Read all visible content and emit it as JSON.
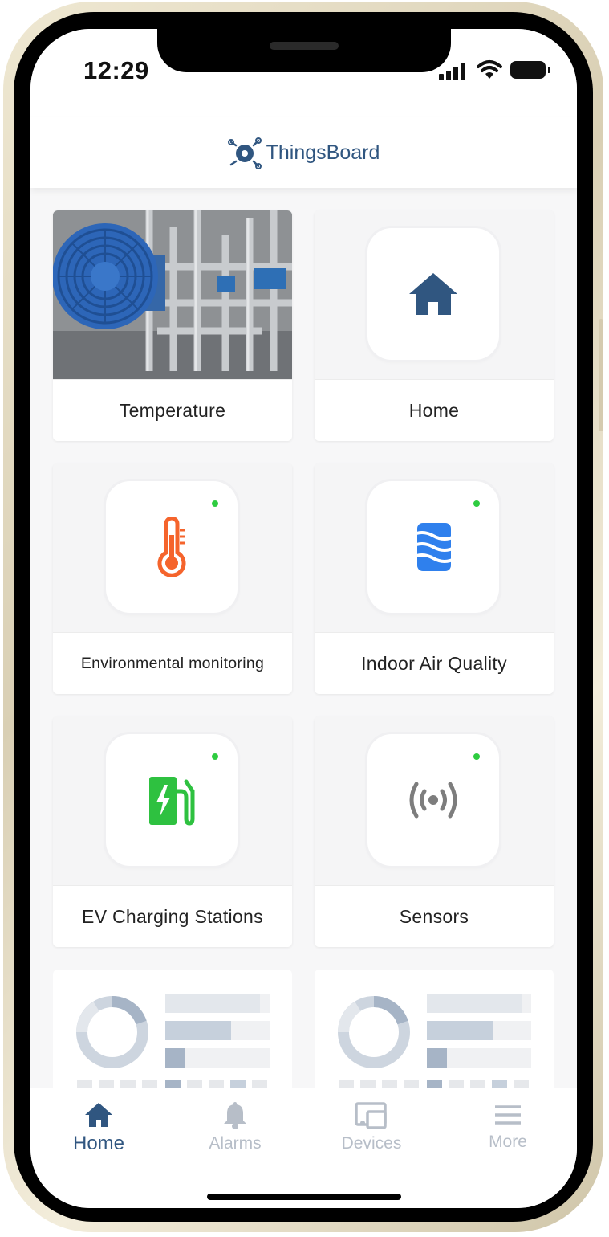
{
  "status_bar": {
    "time": "12:29"
  },
  "header": {
    "title": "ThingsBoard"
  },
  "cards": [
    {
      "label": "Temperature"
    },
    {
      "label": "Home",
      "icon": "home-icon",
      "icon_color": "#305680"
    },
    {
      "label": "Environmental monitoring",
      "icon": "thermometer-icon",
      "icon_color": "#f5642c",
      "online": true
    },
    {
      "label": "Indoor Air Quality",
      "icon": "air-quality-icon",
      "icon_color": "#2f80ed",
      "online": true
    },
    {
      "label": "EV Charging Stations",
      "icon": "ev-charging-icon",
      "icon_color": "#2ec140",
      "online": true
    },
    {
      "label": "Sensors",
      "icon": "sensor-signal-icon",
      "icon_color": "#7d7d7d",
      "online": true
    }
  ],
  "bottom_nav": {
    "items": [
      {
        "label": "Home",
        "icon": "home-icon",
        "active": true
      },
      {
        "label": "Alarms",
        "icon": "bell-icon",
        "active": false
      },
      {
        "label": "Devices",
        "icon": "devices-icon",
        "active": false
      },
      {
        "label": "More",
        "icon": "menu-icon",
        "active": false
      }
    ]
  },
  "colors": {
    "primary": "#305680",
    "online": "#2ecc40",
    "inactive": "#b7bec8"
  }
}
